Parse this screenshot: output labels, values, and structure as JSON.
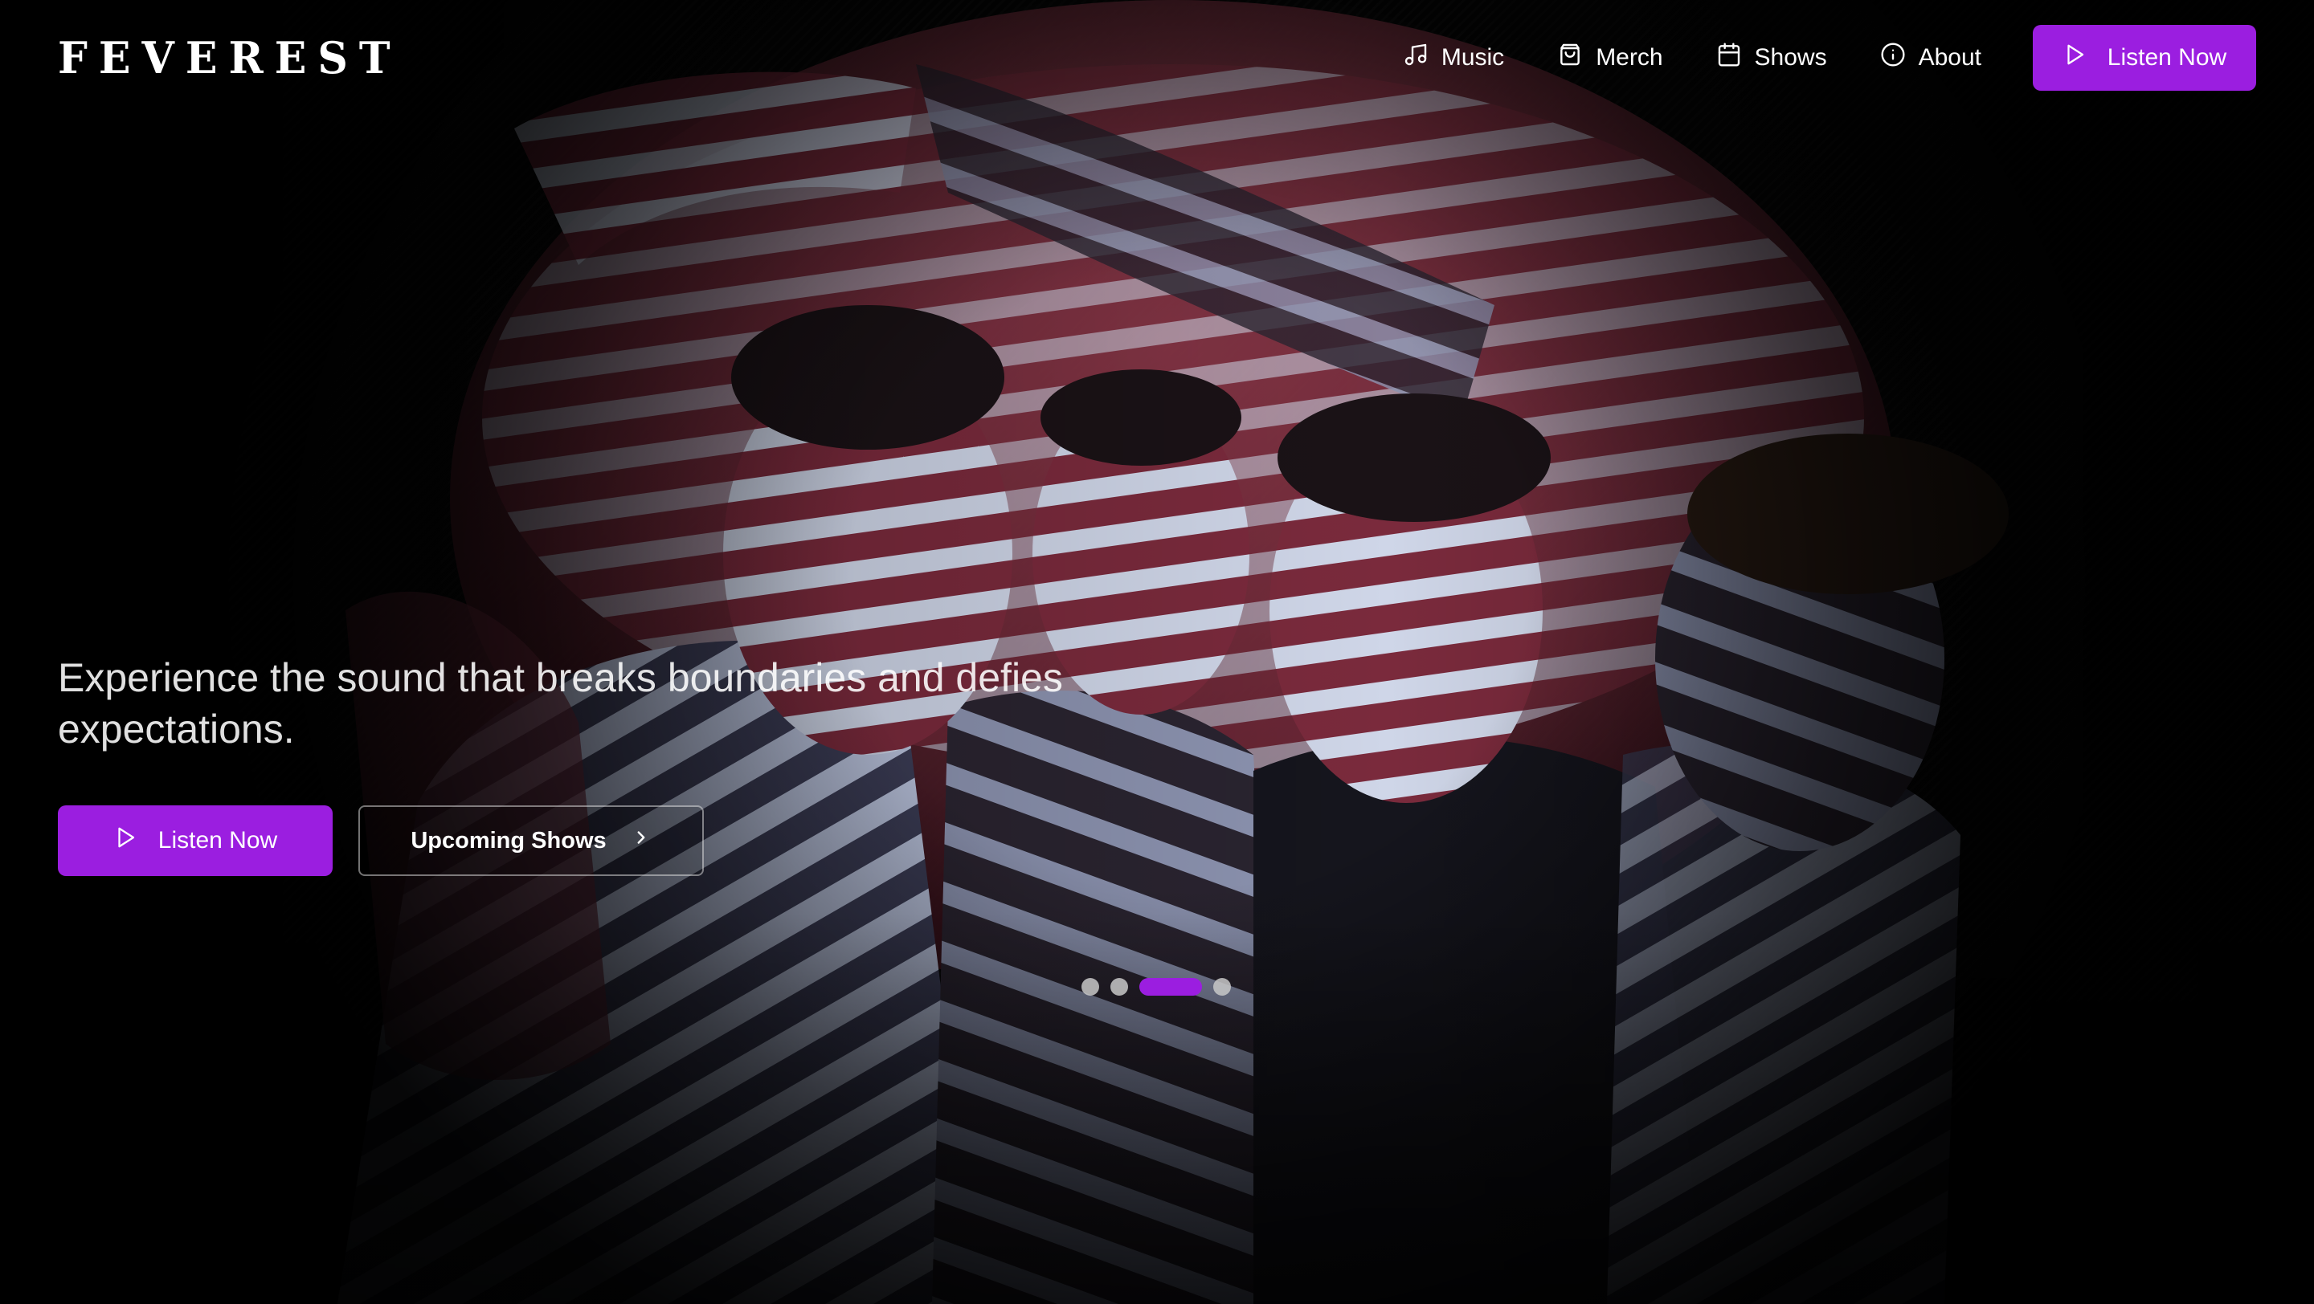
{
  "header": {
    "logo": "FEVEREST",
    "nav": [
      {
        "label": "Music",
        "icon": "music-note-icon"
      },
      {
        "label": "Merch",
        "icon": "shopping-bag-icon"
      },
      {
        "label": "Shows",
        "icon": "calendar-icon"
      },
      {
        "label": "About",
        "icon": "info-icon"
      }
    ],
    "cta_label": "Listen Now",
    "cta_icon": "play-icon"
  },
  "hero": {
    "tagline": "Experience the sound that breaks boundaries and defies expectations.",
    "primary_button": "Listen Now",
    "secondary_button": "Upcoming Shows",
    "secondary_icon": "chevron-right-icon",
    "carousel": {
      "slide_count": 4,
      "active_index": 2
    }
  },
  "colors": {
    "accent": "#9b1ee0",
    "background": "#050505",
    "text": "#ffffff"
  }
}
